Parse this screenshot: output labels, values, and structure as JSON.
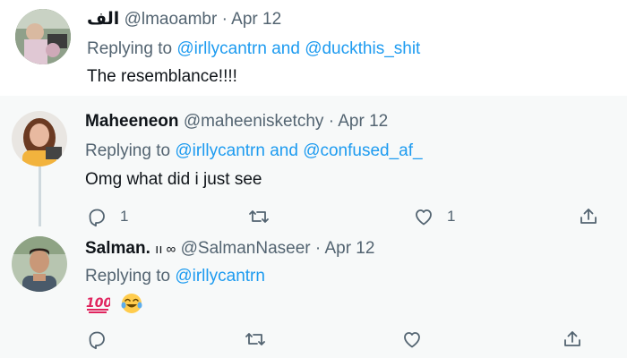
{
  "tweets": [
    {
      "display_name": "الف",
      "handle": "@lmaoambr",
      "separator": "·",
      "date": "Apr 12",
      "replying_prefix": "Replying to",
      "reply_to_1": "@irllycantrn",
      "reply_joiner": "and",
      "reply_to_2": "@duckthis_shit",
      "text": "The resemblance!!!!"
    },
    {
      "display_name": "Maheeneon",
      "handle": "@maheenisketchy",
      "separator": "·",
      "date": "Apr 12",
      "replying_prefix": "Replying to",
      "reply_to_1": "@irllycantrn",
      "reply_joiner": "and",
      "reply_to_2": "@confused_af_",
      "text": "Omg what did i just see",
      "reply_count": "1",
      "like_count": "1"
    },
    {
      "display_name": "Salman.",
      "name_suffix": "ıı ∞",
      "handle": "@SalmanNaseer",
      "separator": "·",
      "date": "Apr 12",
      "replying_prefix": "Replying to",
      "reply_to_1": "@irllycantrn",
      "text_emojis": [
        "hundred-points-emoji",
        "tears-of-joy-emoji"
      ]
    }
  ],
  "colors": {
    "link": "#1d9bf0",
    "secondary_text": "#536471",
    "primary_text": "#0f1419",
    "thread_background": "#f7f9f9"
  },
  "icons": [
    "reply-icon",
    "retweet-icon",
    "like-icon",
    "share-icon"
  ]
}
